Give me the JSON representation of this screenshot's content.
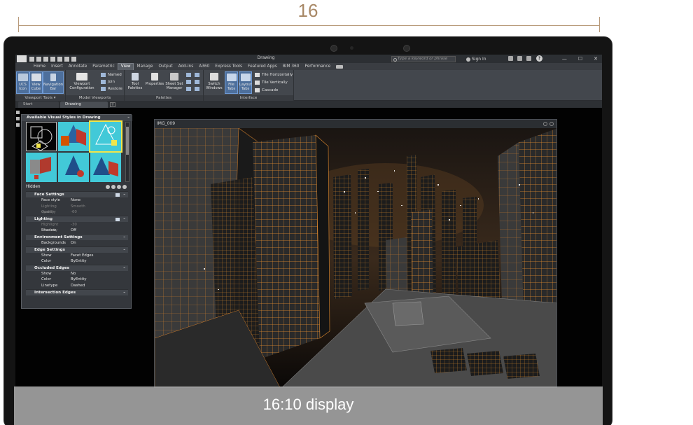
{
  "dimension": {
    "label": "16"
  },
  "banner": {
    "text": "16:10 display"
  },
  "app": {
    "title": "Drawing",
    "search_placeholder": "Type a keyword or phrase",
    "signin_label": "Sign In",
    "help_label": "?",
    "window_buttons": [
      "—",
      "☐",
      "✕"
    ]
  },
  "ribbon_tabs": [
    {
      "label": "Home",
      "active": false
    },
    {
      "label": "Insert",
      "active": false
    },
    {
      "label": "Annotate",
      "active": false
    },
    {
      "label": "Parametric",
      "active": false
    },
    {
      "label": "View",
      "active": true
    },
    {
      "label": "Manage",
      "active": false
    },
    {
      "label": "Output",
      "active": false
    },
    {
      "label": "Add-ins",
      "active": false
    },
    {
      "label": "A360",
      "active": false
    },
    {
      "label": "Express Tools",
      "active": false
    },
    {
      "label": "Featured Apps",
      "active": false
    },
    {
      "label": "BIM 360",
      "active": false
    },
    {
      "label": "Performance",
      "active": false
    }
  ],
  "ribbon": {
    "viewport_tools": {
      "title": "Viewport Tools ▾",
      "ucs_icon": "UCS Icon",
      "view_cube": "View Cube",
      "navigation_bar": "Navigation Bar"
    },
    "model_viewports": {
      "title": "Model Viewports",
      "viewport_configuration": "Viewport Configuration",
      "named": "Named",
      "join": "Join",
      "restore": "Restore"
    },
    "palettes": {
      "title": "Palettes",
      "tool_palettes": "Tool Palettes",
      "properties": "Properties",
      "sheet_set_manager": "Sheet Set Manager"
    },
    "interface": {
      "title": "Interface",
      "switch_windows": "Switch Windows",
      "file_tabs": "File Tabs",
      "layout_tabs": "Layout Tabs",
      "tile_horizontally": "Tile Horizontally",
      "tile_vertically": "Tile Vertically",
      "cascade": "Cascade"
    }
  },
  "doc_tabs": [
    {
      "label": "Start",
      "active": false
    },
    {
      "label": "Drawing",
      "active": true
    }
  ],
  "visual_styles": {
    "title": "Available Visual Styles in Drawing",
    "current": "Hidden",
    "sections": [
      {
        "name": "Face Settings",
        "rows": [
          {
            "key": "Face style",
            "value": "None",
            "disabled": false
          },
          {
            "key": "Lighting quality",
            "value": "Smooth",
            "disabled": true
          },
          {
            "key": "Opacity",
            "value": "-60",
            "disabled": true
          }
        ]
      },
      {
        "name": "Lighting",
        "rows": [
          {
            "key": "Highlight intensity",
            "value": "-30",
            "disabled": true
          },
          {
            "key": "Shadow display",
            "value": "Off",
            "disabled": false
          }
        ]
      },
      {
        "name": "Environment Settings",
        "rows": [
          {
            "key": "Backgrounds",
            "value": "On",
            "disabled": false
          }
        ]
      },
      {
        "name": "Edge Settings",
        "rows": [
          {
            "key": "Show",
            "value": "Facet Edges",
            "disabled": false
          },
          {
            "key": "Color",
            "value": "ByEntity",
            "disabled": false
          }
        ]
      },
      {
        "name": "Occluded Edges",
        "rows": [
          {
            "key": "Show",
            "value": "No",
            "disabled": false
          },
          {
            "key": "Color",
            "value": "ByEntity",
            "disabled": false
          },
          {
            "key": "Linetype",
            "value": "Dashed",
            "disabled": false
          }
        ]
      },
      {
        "name": "Intersection Edges",
        "rows": []
      }
    ]
  },
  "viewport": {
    "title": "IMG_009"
  },
  "colors": {
    "accent_wire": "#e08a2e",
    "frame": "#141414",
    "ribbon": "#43474d",
    "dimension": "#a88866"
  }
}
